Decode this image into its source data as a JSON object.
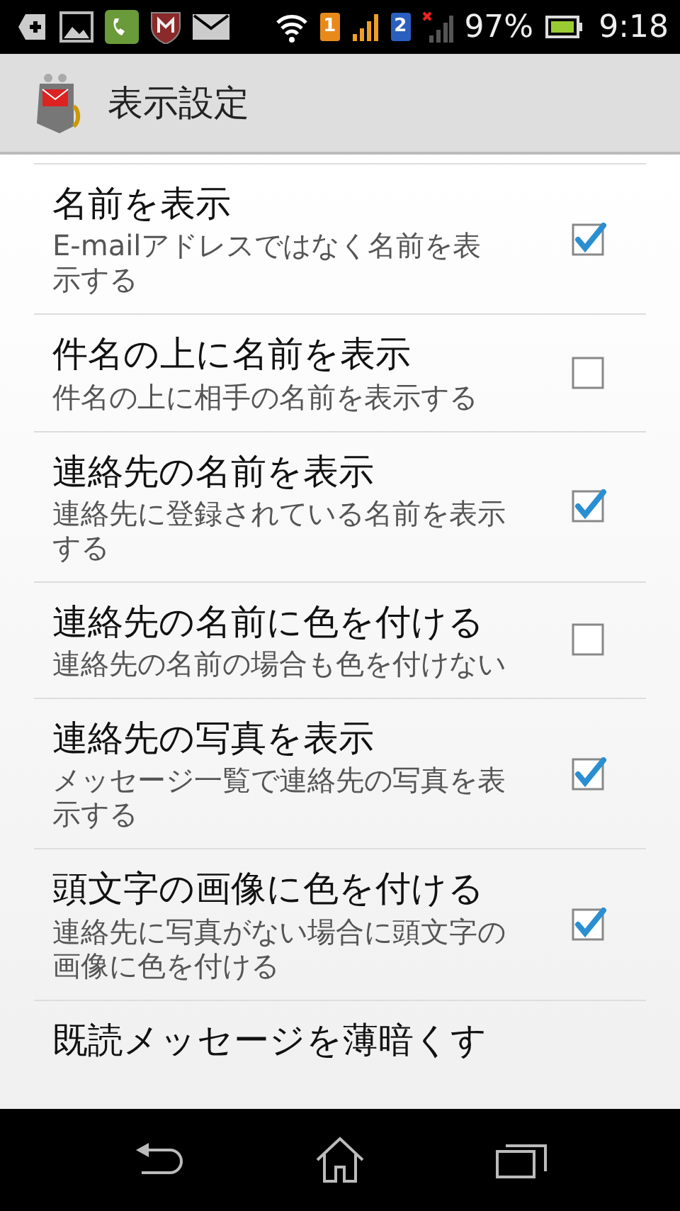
{
  "status_bar": {
    "sim_1": "1",
    "sim_2": "2",
    "battery": "97%",
    "time": "9:18"
  },
  "action_bar": {
    "title": "表示設定"
  },
  "settings": [
    {
      "title": "名前を表示",
      "summary": "E-mailアドレスではなく名前を表示する",
      "checked": true
    },
    {
      "title": "件名の上に名前を表示",
      "summary": "件名の上に相手の名前を表示する",
      "checked": false
    },
    {
      "title": "連絡先の名前を表示",
      "summary": "連絡先に登録されている名前を表示する",
      "checked": true
    },
    {
      "title": "連絡先の名前に色を付ける",
      "summary": "連絡先の名前の場合も色を付けない",
      "checked": false
    },
    {
      "title": "連絡先の写真を表示",
      "summary": "メッセージ一覧で連絡先の写真を表示する",
      "checked": true
    },
    {
      "title": "頭文字の画像に色を付ける",
      "summary": "連絡先に写真がない場合に頭文字の画像に色を付ける",
      "checked": true
    },
    {
      "title": "既読メッセージを薄暗くす"
    }
  ]
}
